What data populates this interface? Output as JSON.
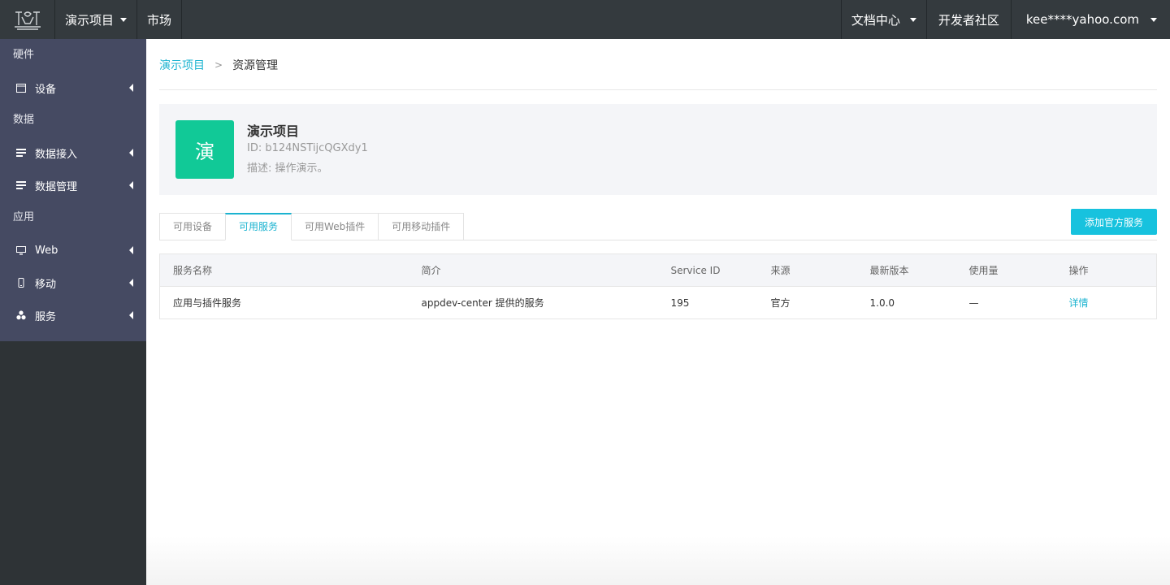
{
  "topbar": {
    "logo_icon": "iot-logo-icon",
    "project_menu": "演示项目",
    "market": "市场",
    "docs": "文档中心",
    "community": "开发者社区",
    "user": "kee****yahoo.com"
  },
  "sidebar": {
    "groups": [
      {
        "title": "硬件",
        "items": [
          {
            "label": "设备",
            "icon": "calendar-icon"
          }
        ]
      },
      {
        "title": "数据",
        "items": [
          {
            "label": "数据接入",
            "icon": "list-icon"
          },
          {
            "label": "数据管理",
            "icon": "list-icon"
          }
        ]
      },
      {
        "title": "应用",
        "items": [
          {
            "label": "Web",
            "icon": "monitor-icon"
          },
          {
            "label": "移动",
            "icon": "mobile-icon"
          },
          {
            "label": "服务",
            "icon": "cluster-icon"
          }
        ]
      }
    ]
  },
  "breadcrumb": {
    "parent": "演示项目",
    "separator": ">",
    "current": "资源管理"
  },
  "project": {
    "avatar_char": "演",
    "name": "演示项目",
    "id_text": "ID: b124NSTijcQGXdy1",
    "desc_text": "描述: 操作演示。",
    "avatar_color": "#11c997"
  },
  "tabs": [
    "可用设备",
    "可用服务",
    "可用Web插件",
    "可用移动插件"
  ],
  "active_tab": "可用服务",
  "add_button": "添加官方服务",
  "table": {
    "headers": [
      "服务名称",
      "简介",
      "Service ID",
      "来源",
      "最新版本",
      "使用量",
      "操作"
    ],
    "rows": [
      [
        "应用与插件服务",
        "appdev-center 提供的服务",
        "195",
        "官方",
        "1.0.0",
        "—",
        "详情"
      ]
    ]
  },
  "colors": {
    "accent": "#1bb3d0",
    "topbar": "#343a3e",
    "sidebar_menu": "#454a62",
    "sidebar_bg": "#2e3336"
  }
}
